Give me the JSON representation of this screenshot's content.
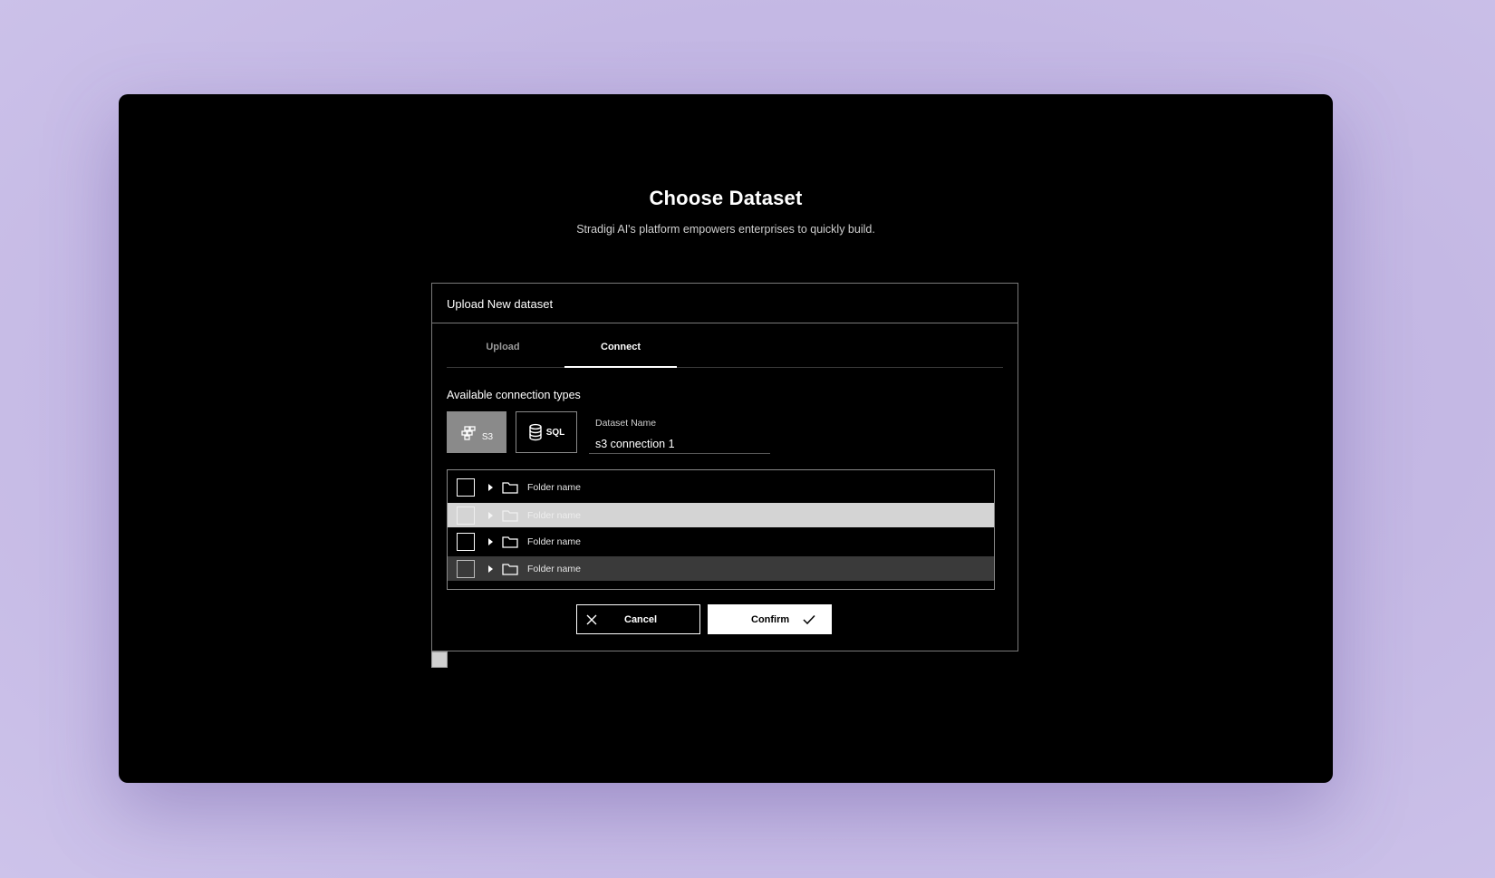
{
  "page": {
    "title": "Choose Dataset",
    "subtitle": "Stradigi AI's platform empowers enterprises to quickly build."
  },
  "panel": {
    "header": "Upload New dataset",
    "tabs": [
      {
        "label": "Upload",
        "active": false
      },
      {
        "label": "Connect",
        "active": true
      }
    ],
    "section_label": "Available connection types",
    "connection_types": [
      {
        "label": "S3",
        "icon": "s3-bucket-icon",
        "selected": true
      },
      {
        "label": "SQL",
        "icon": "database-icon",
        "selected": false
      }
    ],
    "dataset_name": {
      "label": "Dataset Name",
      "value": "s3 connection 1"
    },
    "folders": [
      {
        "label": "Folder name",
        "state": "default"
      },
      {
        "label": "Folder name",
        "state": "disabled"
      },
      {
        "label": "Folder name",
        "state": "default"
      },
      {
        "label": "Folder name",
        "state": "hover"
      }
    ],
    "actions": {
      "cancel_label": "Cancel",
      "confirm_label": "Confirm"
    }
  },
  "colors": {
    "background": "#c4b8e4",
    "window": "#000000",
    "selected_connection": "#8a8a8a",
    "row_disabled": "#d4d4d4",
    "row_hover": "#3a3a3a"
  }
}
